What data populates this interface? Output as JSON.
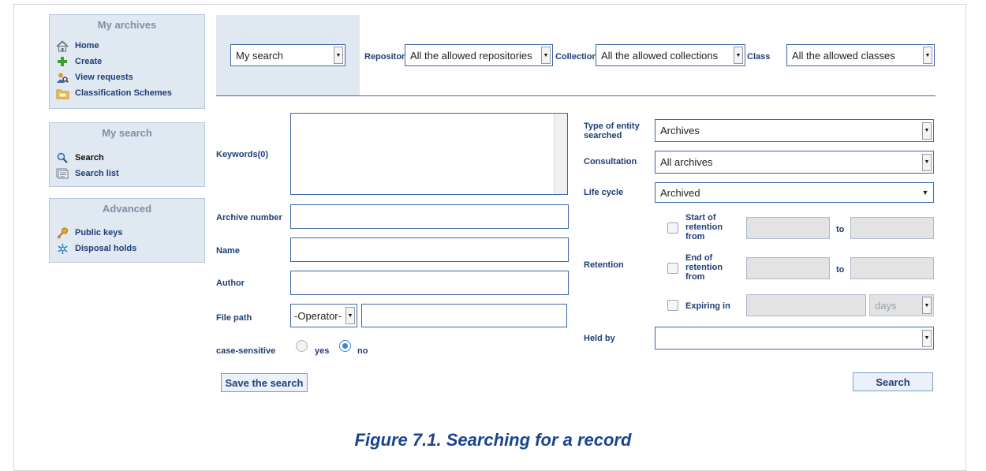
{
  "sidebar": {
    "my_archives": {
      "title": "My archives",
      "items": [
        {
          "label": "Home",
          "icon": "home-icon"
        },
        {
          "label": "Create",
          "icon": "plus-icon"
        },
        {
          "label": "View requests",
          "icon": "user-search-icon"
        },
        {
          "label": "Classification Schemes",
          "icon": "folder-icon"
        }
      ]
    },
    "my_search": {
      "title": "My search",
      "items": [
        {
          "label": "Search",
          "icon": "magnifier-icon"
        },
        {
          "label": "Search list",
          "icon": "list-icon"
        }
      ]
    },
    "advanced": {
      "title": "Advanced",
      "items": [
        {
          "label": "Public keys",
          "icon": "key-icon"
        },
        {
          "label": "Disposal holds",
          "icon": "snowflake-icon"
        }
      ]
    }
  },
  "toolbar": {
    "saved_search": "My search",
    "repository_label": "Repository",
    "repository_value": "All the allowed repositories",
    "collection_label": "Collection",
    "collection_value": "All the allowed collections",
    "class_label": "Class",
    "class_value": "All the allowed classes"
  },
  "form": {
    "keywords_label": "Keywords(0)",
    "archive_number_label": "Archive number",
    "name_label": "Name",
    "author_label": "Author",
    "file_path_label": "File path",
    "file_path_operator": "-Operator-",
    "case_sensitive_label": "case-sensitive",
    "case_yes": "yes",
    "case_no": "no",
    "case_selected": "no",
    "entity_type_label_1": "Type of entity",
    "entity_type_label_2": "searched",
    "entity_type_value": "Archives",
    "consultation_label": "Consultation",
    "consultation_value": "All archives",
    "life_cycle_label": "Life cycle",
    "life_cycle_value": "Archived",
    "retention_label": "Retention",
    "start_retention_1": "Start of",
    "start_retention_2": "retention",
    "start_retention_3": "from",
    "end_retention_1": "End of",
    "end_retention_2": "retention",
    "end_retention_3": "from",
    "to_label": "to",
    "expiring_label": "Expiring in",
    "expiring_unit": "days",
    "held_by_label": "Held by",
    "held_by_value": ""
  },
  "buttons": {
    "save_search": "Save the search",
    "search": "Search"
  },
  "caption": "Figure 7.1. Searching for a record",
  "colors": {
    "panel_bg": "#e0e8f1",
    "label_blue": "#1f3d78",
    "caption_blue": "#1a4490",
    "border_blue": "#3a67a8"
  }
}
